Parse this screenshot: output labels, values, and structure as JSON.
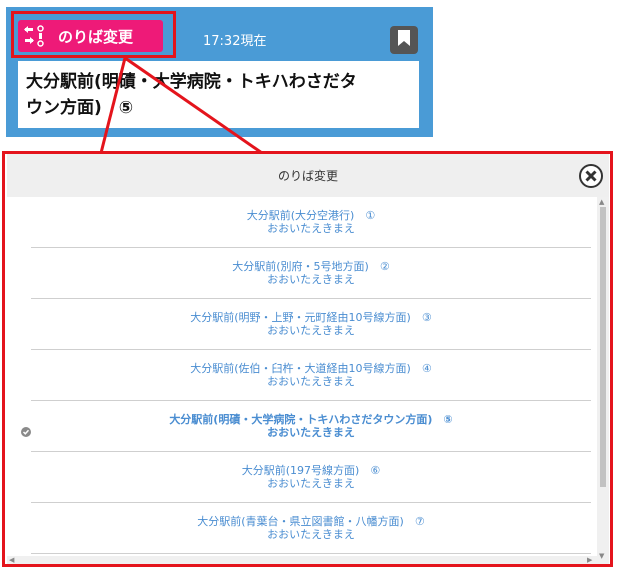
{
  "header": {
    "change_label": "のりば変更",
    "time_text": "17:32現在",
    "stop_title": "大分駅前(明磧・大学病院・トキハわさだタウン方面)　⑤"
  },
  "modal": {
    "title": "のりば変更",
    "items": [
      {
        "name": "大分駅前(大分空港行)　①",
        "kana": "おおいたえきまえ"
      },
      {
        "name": "大分駅前(別府・5号地方面)　②",
        "kana": "おおいたえきまえ"
      },
      {
        "name": "大分駅前(明野・上野・元町経由10号線方面)　③",
        "kana": "おおいたえきまえ"
      },
      {
        "name": "大分駅前(佐伯・臼杵・大道経由10号線方面)　④",
        "kana": "おおいたえきまえ"
      },
      {
        "name": "大分駅前(明磧・大学病院・トキハわさだタウン方面)　⑤",
        "kana": "おおいたえきまえ"
      },
      {
        "name": "大分駅前(197号線方面)　⑥",
        "kana": "おおいたえきまえ"
      },
      {
        "name": "大分駅前(青葉台・県立図書館・八幡方面)　⑦",
        "kana": "おおいたえきまえ"
      }
    ],
    "selected_index": 4
  },
  "icons": {
    "swap": "swap-arrows-icon",
    "bookmark": "bookmark-icon",
    "close": "close-circle-icon",
    "check": "check-icon"
  },
  "colors": {
    "header_blue": "#4a9bd6",
    "button_pink": "#ee1a78",
    "link_blue": "#4a8dd1",
    "highlight_red": "#e4141c"
  }
}
